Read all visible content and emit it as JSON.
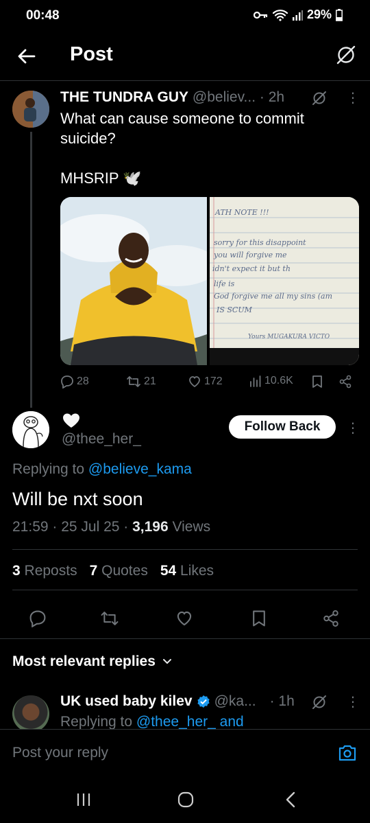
{
  "status_bar": {
    "time": "00:48",
    "battery": "29%"
  },
  "header": {
    "title": "Post"
  },
  "tweet": {
    "author_name": "THE TUNDRA GUY",
    "author_handle": "@believ...",
    "age": "· 2h",
    "text": "What can cause someone to commit suicide?\n\nMHSRIP 🕊️",
    "note_lines": [
      "ATH NOTE !!!",
      "sorry for this disappoint",
      "you will forgive me",
      "idn't expect it but th",
      "life is",
      "God forgive me all my sins (am",
      "IS SCUM",
      "Yours MUGAKURA VICTO"
    ],
    "replies": "28",
    "reposts": "21",
    "likes": "172",
    "views": "10.6K"
  },
  "reply": {
    "display_name": "🤍",
    "handle": "@thee_her_",
    "follow_label": "Follow Back",
    "replying_prefix": "Replying to",
    "replying_to": "@believe_kama",
    "text": "Will be nxt soon",
    "timestamp": "21:59 · 25 Jul 25 · ",
    "views_count": "3,196",
    "views_label": " Views",
    "reposts_count": "3",
    "reposts_label": "Reposts",
    "quotes_count": "7",
    "quotes_label": "Quotes",
    "likes_count": "54",
    "likes_label": "Likes"
  },
  "section": {
    "most_relevant": "Most relevant replies"
  },
  "next_reply": {
    "author_name": "UK used baby kilev",
    "author_handle": "@ka...",
    "age": "· 1h",
    "replying_prefix": "Replying to",
    "replying_to": "@thee_her_ and"
  },
  "composer": {
    "placeholder": "Post your reply"
  },
  "colors": {
    "accent": "#1d9bf0",
    "verified": "#1d9bf0",
    "background": "#000000"
  }
}
